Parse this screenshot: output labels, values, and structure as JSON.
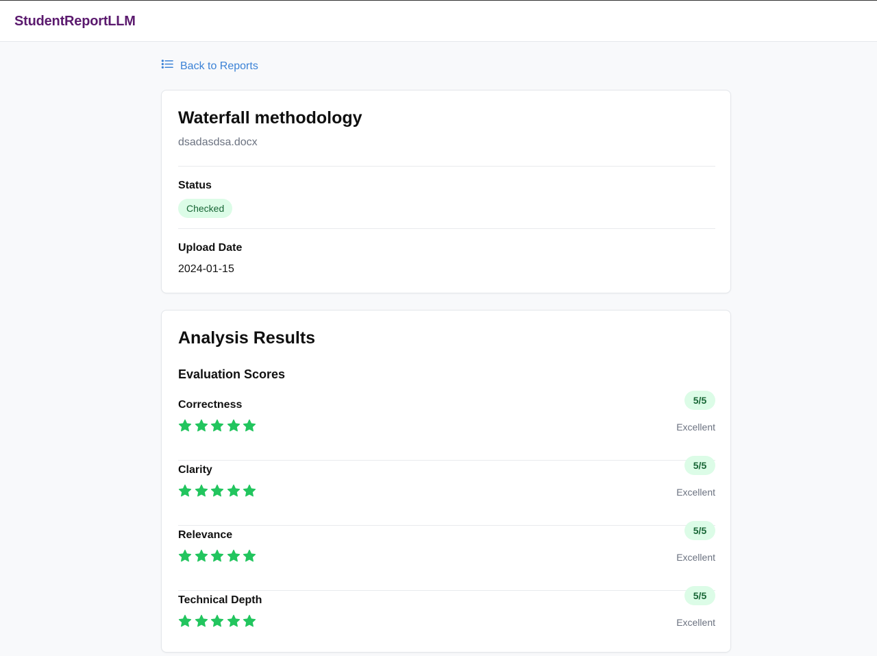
{
  "app": {
    "brand": "StudentReportLLM"
  },
  "nav": {
    "back_label": "Back to Reports"
  },
  "report": {
    "title": "Waterfall methodology",
    "filename": "dsadasdsa.docx",
    "status_label": "Status",
    "status_value": "Checked",
    "upload_label": "Upload Date",
    "upload_value": "2024-01-15"
  },
  "analysis": {
    "title": "Analysis Results",
    "scores_title": "Evaluation Scores",
    "scores": [
      {
        "name": "Correctness",
        "score": "5/5",
        "rating": 5,
        "max": 5,
        "desc": "Excellent"
      },
      {
        "name": "Clarity",
        "score": "5/5",
        "rating": 5,
        "max": 5,
        "desc": "Excellent"
      },
      {
        "name": "Relevance",
        "score": "5/5",
        "rating": 5,
        "max": 5,
        "desc": "Excellent"
      },
      {
        "name": "Technical Depth",
        "score": "5/5",
        "rating": 5,
        "max": 5,
        "desc": "Excellent"
      }
    ]
  },
  "colors": {
    "brand": "#5b1a6e",
    "link": "#3b82d6",
    "star": "#22c55e",
    "badge_bg": "#dcfce7",
    "badge_text": "#166534"
  },
  "icons": {
    "back": "list-icon",
    "rating": "star-icon"
  }
}
